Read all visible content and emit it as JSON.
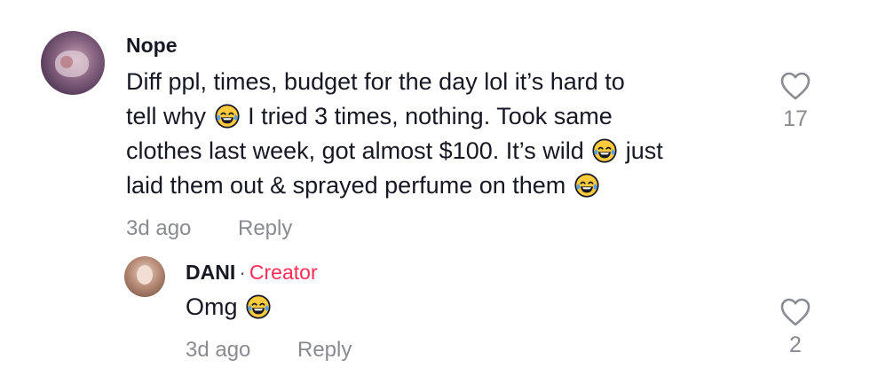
{
  "comment": {
    "username": "Nope",
    "lines": [
      [
        "Diff ppl, times, budget for the day lol it’s hard to"
      ],
      [
        "tell why ",
        " I tried 3 times, nothing. Took same"
      ],
      [
        "clothes last week, got almost $100. It’s wild ",
        " just"
      ],
      [
        "laid them out & sprayed perfume on them "
      ]
    ],
    "line1": "Diff ppl, times, budget for the day lol it’s hard to",
    "line2_a": "tell why",
    "line2_b": "I tried 3 times, nothing. Took same",
    "line3_a": "clothes last week, got almost $100. It’s wild",
    "line3_b": "just",
    "line4": "laid them out & sprayed perfume on them",
    "time": "3d ago",
    "reply_label": "Reply",
    "likes": "17",
    "emoji_icon": "face-with-tears-of-joy-icon"
  },
  "reply": {
    "username": "DANI",
    "separator": "·",
    "badge": "Creator",
    "text": "Omg",
    "time": "3d ago",
    "reply_label": "Reply",
    "likes": "2"
  },
  "colors": {
    "text": "#161823",
    "muted": "#8a8b91",
    "creator": "#fe2c55"
  }
}
